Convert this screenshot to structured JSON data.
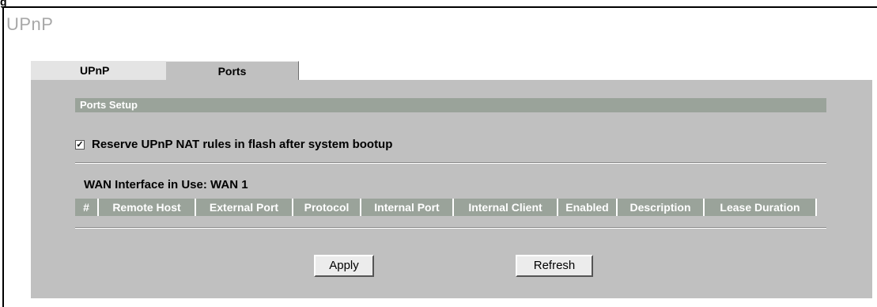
{
  "figure_label": "g",
  "page_title": "UPnP",
  "tabs": [
    {
      "label": "UPnP"
    },
    {
      "label": "Ports"
    }
  ],
  "section_title": "Ports Setup",
  "reserve_option": {
    "label": "Reserve UPnP NAT rules in flash after system bootup",
    "checked": true
  },
  "wan_label": "WAN Interface in Use: WAN 1",
  "table": {
    "columns": [
      "#",
      "Remote Host",
      "External Port",
      "Protocol",
      "Internal Port",
      "Internal Client",
      "Enabled",
      "Description",
      "Lease Duration"
    ],
    "rows": []
  },
  "buttons": {
    "apply": "Apply",
    "refresh": "Refresh"
  }
}
